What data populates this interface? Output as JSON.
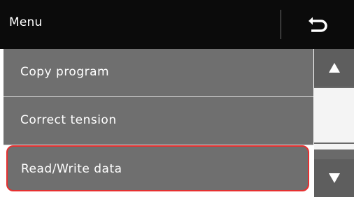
{
  "header": {
    "title": "Menu",
    "back_icon": "return-arrow-icon"
  },
  "menu": {
    "items": [
      {
        "label": "Copy program"
      },
      {
        "label": "Correct tension"
      },
      {
        "label": "Read/Write data",
        "highlighted": true
      }
    ]
  },
  "scrollbar": {
    "up_icon": "triangle-up-icon",
    "down_icon": "triangle-down-icon"
  },
  "colors": {
    "header_bg": "#0b0b0b",
    "item_bg": "#6f6f6f",
    "highlight_border": "#e63030",
    "scroll_button_bg": "#5e5e5e"
  }
}
